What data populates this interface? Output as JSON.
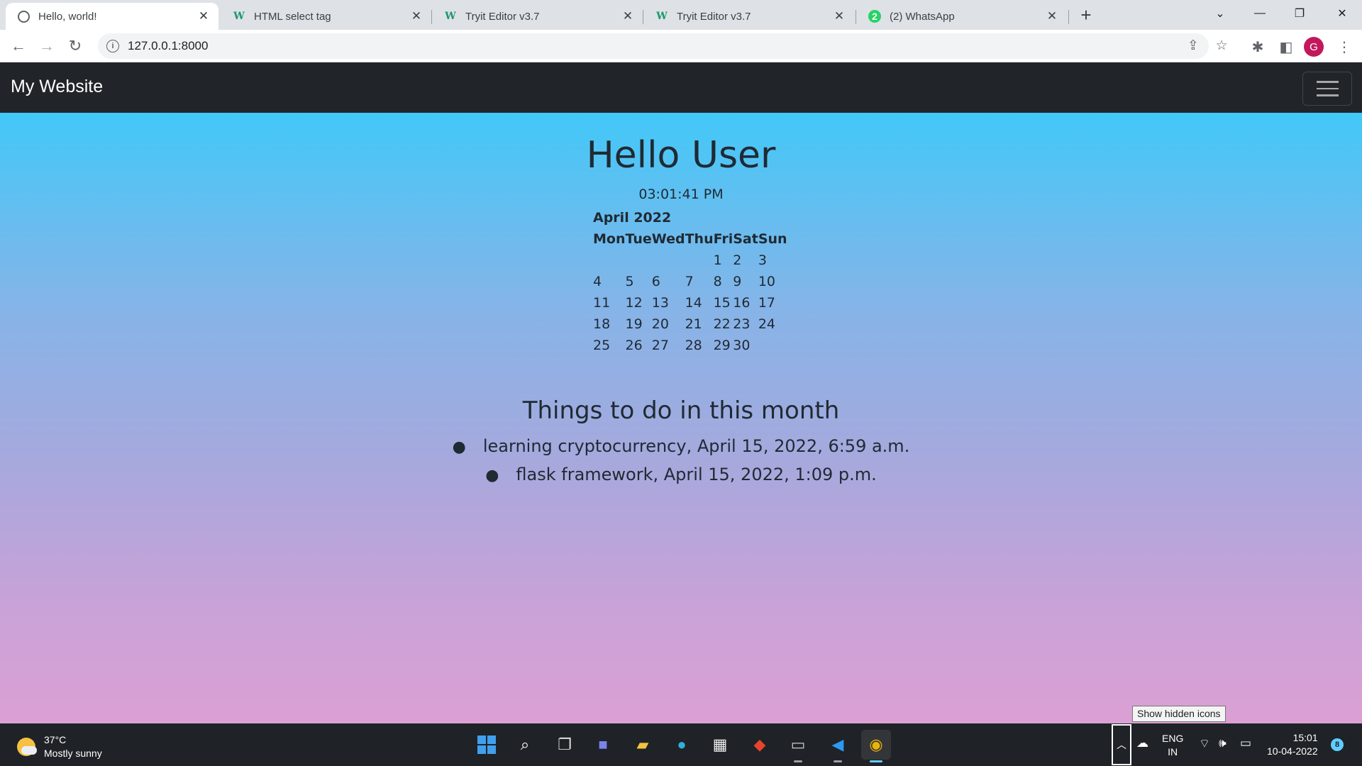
{
  "browser": {
    "tabs": [
      {
        "title": "Hello, world!",
        "icon": "globe-icon",
        "active": true
      },
      {
        "title": "HTML select tag",
        "icon": "w3schools-icon",
        "active": false
      },
      {
        "title": "Tryit Editor v3.7",
        "icon": "w3schools-icon",
        "active": false
      },
      {
        "title": "Tryit Editor v3.7",
        "icon": "w3schools-icon",
        "active": false
      },
      {
        "title": "(2) WhatsApp",
        "icon": "whatsapp-icon",
        "badge": "2",
        "active": false
      }
    ],
    "url": "127.0.0.1:8000",
    "profile_initial": "G",
    "profile_color": "#c2185b"
  },
  "site": {
    "brand": "My Website",
    "heading": "Hello User",
    "time": "03:01:41 PM",
    "calendar": {
      "month": "April 2022",
      "weekdays": [
        "Mon",
        "Tue",
        "Wed",
        "Thu",
        "Fri",
        "Sat",
        "Sun"
      ],
      "weeks": [
        [
          "",
          "",
          "",
          "",
          "1",
          "2",
          "3"
        ],
        [
          "4",
          "5",
          "6",
          "7",
          "8",
          "9",
          "10"
        ],
        [
          "11",
          "12",
          "13",
          "14",
          "15",
          "16",
          "17"
        ],
        [
          "18",
          "19",
          "20",
          "21",
          "22",
          "23",
          "24"
        ],
        [
          "25",
          "26",
          "27",
          "28",
          "29",
          "30",
          ""
        ]
      ]
    },
    "todo_title": "Things to do in this month",
    "todos": [
      "learning cryptocurrency, April 15, 2022, 6:59 a.m.",
      "flask framework, April 15, 2022, 1:09 p.m."
    ],
    "colors": {
      "navbar": "#212529",
      "gradient_top": "#42c8f8",
      "gradient_bottom": "#dba0d4"
    }
  },
  "taskbar": {
    "weather_temp": "37°C",
    "weather_text": "Mostly sunny",
    "tooltip": "Show hidden icons",
    "lang_line1": "ENG",
    "lang_line2": "IN",
    "time": "15:01",
    "date": "10-04-2022",
    "notification_count": "8"
  }
}
